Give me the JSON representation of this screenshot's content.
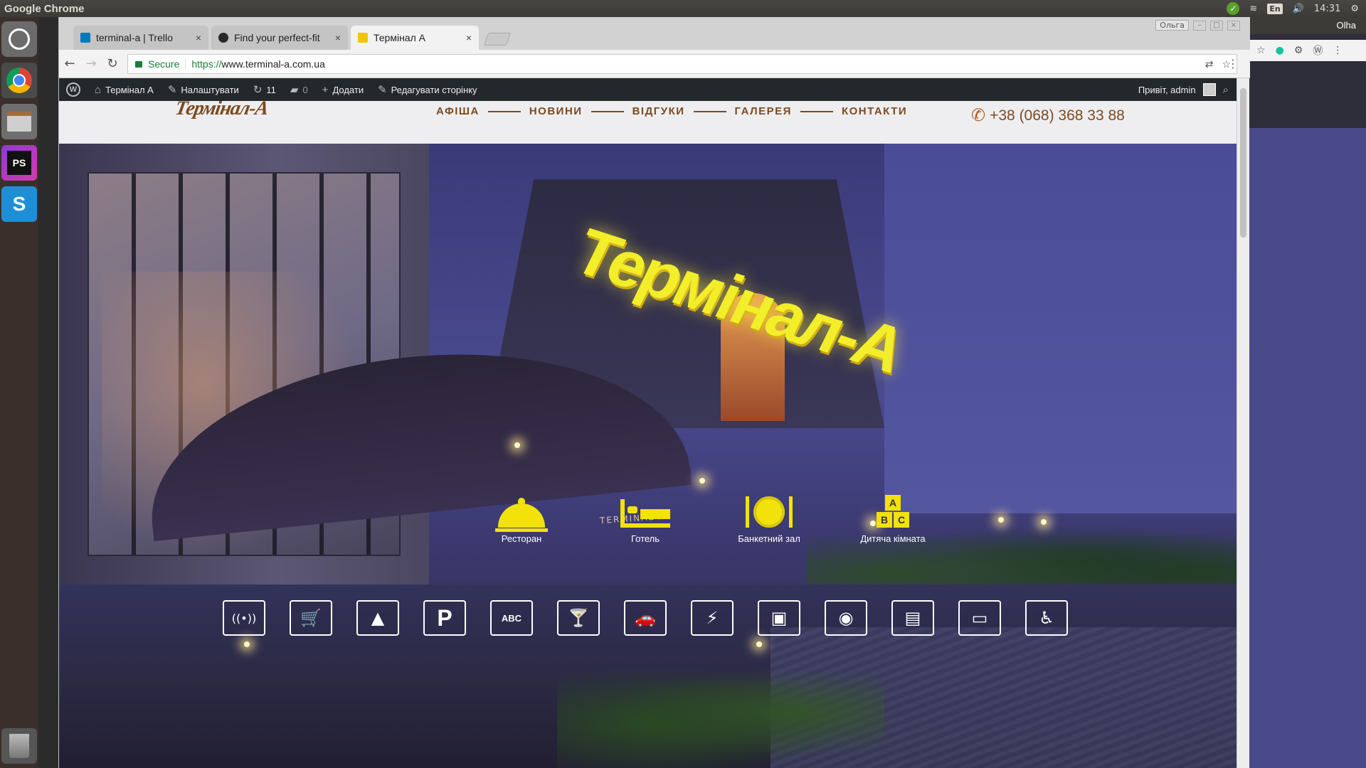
{
  "os": {
    "window_title": "Google Chrome",
    "clock": "14:31",
    "keyboard_layout": "En",
    "desktop_user": "Olha"
  },
  "browser": {
    "tabs": [
      {
        "title": "terminal-a | Trello",
        "active": false,
        "favicon_color": "#0079bf"
      },
      {
        "title": "Find your perfect-fit",
        "active": false,
        "favicon_color": "#2a2a2a"
      },
      {
        "title": "Термінал А",
        "active": true,
        "favicon_color": "#f2c40a"
      }
    ],
    "profile_name": "Ольга",
    "secure_label": "Secure",
    "url_scheme": "https://",
    "url_rest": "www.terminal-a.com.ua"
  },
  "wp_admin_bar": {
    "site_name": "Термінал А",
    "customize": "Налаштувати",
    "updates_count": "11",
    "comments_count": "0",
    "add_new": "Додати",
    "edit_page": "Редагувати сторінку",
    "greeting": "Привіт, admin"
  },
  "site": {
    "logo_text": "Термінал-А",
    "nav": [
      "АФІША",
      "НОВИНИ",
      "ВІДГУКИ",
      "ГАЛЕРЕЯ",
      "КОНТАКТИ"
    ],
    "phone": "+38 (068) 368 33 88",
    "hero_sign": "Термінал-А",
    "hero_small_sign": "TERMINAL A",
    "services": [
      {
        "label": "Ресторан",
        "icon": "cloche-icon"
      },
      {
        "label": "Готель",
        "icon": "bed-icon"
      },
      {
        "label": "Банкетний зал",
        "icon": "plate-icon"
      },
      {
        "label": "Дитяча кімната",
        "icon": "abc-blocks-icon"
      }
    ],
    "abc_letters": [
      "A",
      "B",
      "C"
    ],
    "amenities": [
      {
        "icon": "wifi-icon",
        "glyph": "((•))"
      },
      {
        "icon": "shopping-cart-icon",
        "glyph": "🛒"
      },
      {
        "icon": "pyramid-icon",
        "glyph": "▲"
      },
      {
        "icon": "parking-icon",
        "glyph": "P"
      },
      {
        "icon": "kids-room-icon",
        "glyph": "ABC"
      },
      {
        "icon": "cocktail-icon",
        "glyph": "🍸"
      },
      {
        "icon": "car-wash-icon",
        "glyph": "🚗"
      },
      {
        "icon": "ev-charging-icon",
        "glyph": "⚡"
      },
      {
        "icon": "atm-icon",
        "glyph": "▣"
      },
      {
        "icon": "room-service-icon",
        "glyph": "◉"
      },
      {
        "icon": "terminal-payment-icon",
        "glyph": "▤"
      },
      {
        "icon": "credit-card-icon",
        "glyph": "▭"
      },
      {
        "icon": "wheelchair-icon",
        "glyph": "♿"
      }
    ],
    "colors": {
      "brand_brown": "#7c4a1f",
      "sign_yellow": "#f2ee2a",
      "icon_yellow": "#f2e20a"
    }
  }
}
